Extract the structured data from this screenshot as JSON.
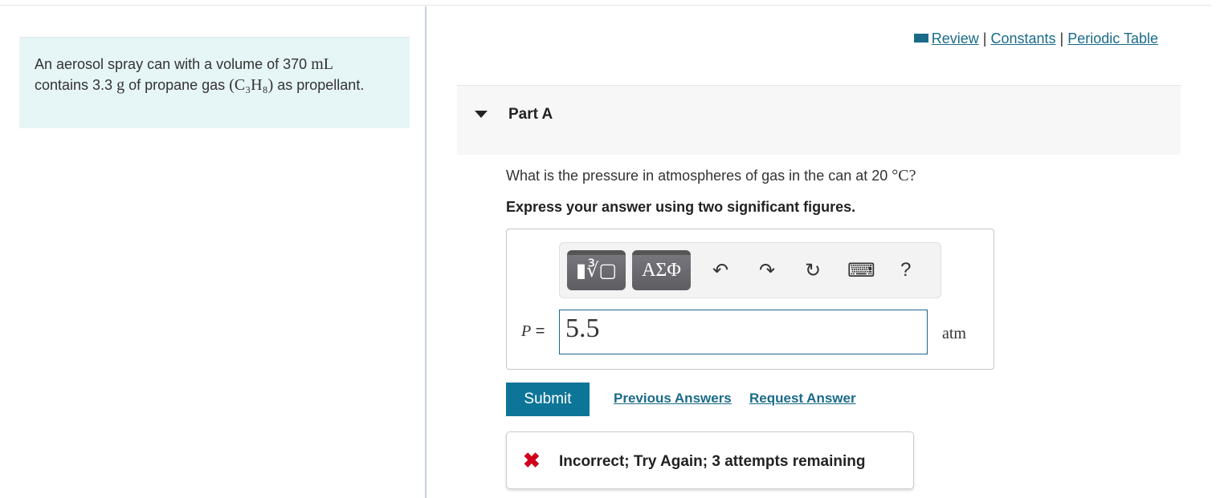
{
  "problem": {
    "text1": "An aerosol spray can with a volume of 370 ",
    "unit_ml": "mL",
    "text2": "contains 3.3 ",
    "unit_g": "g",
    "text3": " of propane gas ",
    "formula": "(C₃H₈)",
    "text4": " as propellant."
  },
  "links": {
    "review": "Review",
    "constants": "Constants",
    "periodic": "Periodic Table",
    "sep": "|"
  },
  "part": {
    "label": "Part A"
  },
  "question": {
    "text": "What is the pressure in atmospheres of gas in the can at 20 ",
    "unit": "°C",
    "end": "?",
    "instruction": "Express your answer using two significant figures."
  },
  "toolbar": {
    "templates": "▮∛▢",
    "greek": "ΑΣΦ",
    "undo": "↶",
    "redo": "↷",
    "reset": "↻",
    "keyboard": "⌨",
    "help": "?"
  },
  "answer": {
    "label": "P",
    "equals": " =",
    "value": "5.5",
    "unit": "atm"
  },
  "actions": {
    "submit": "Submit",
    "previous": "Previous Answers",
    "request": "Request Answer"
  },
  "feedback": {
    "icon": "✖",
    "text": "Incorrect; Try Again; 3 attempts remaining",
    "color": "#d0021b"
  }
}
